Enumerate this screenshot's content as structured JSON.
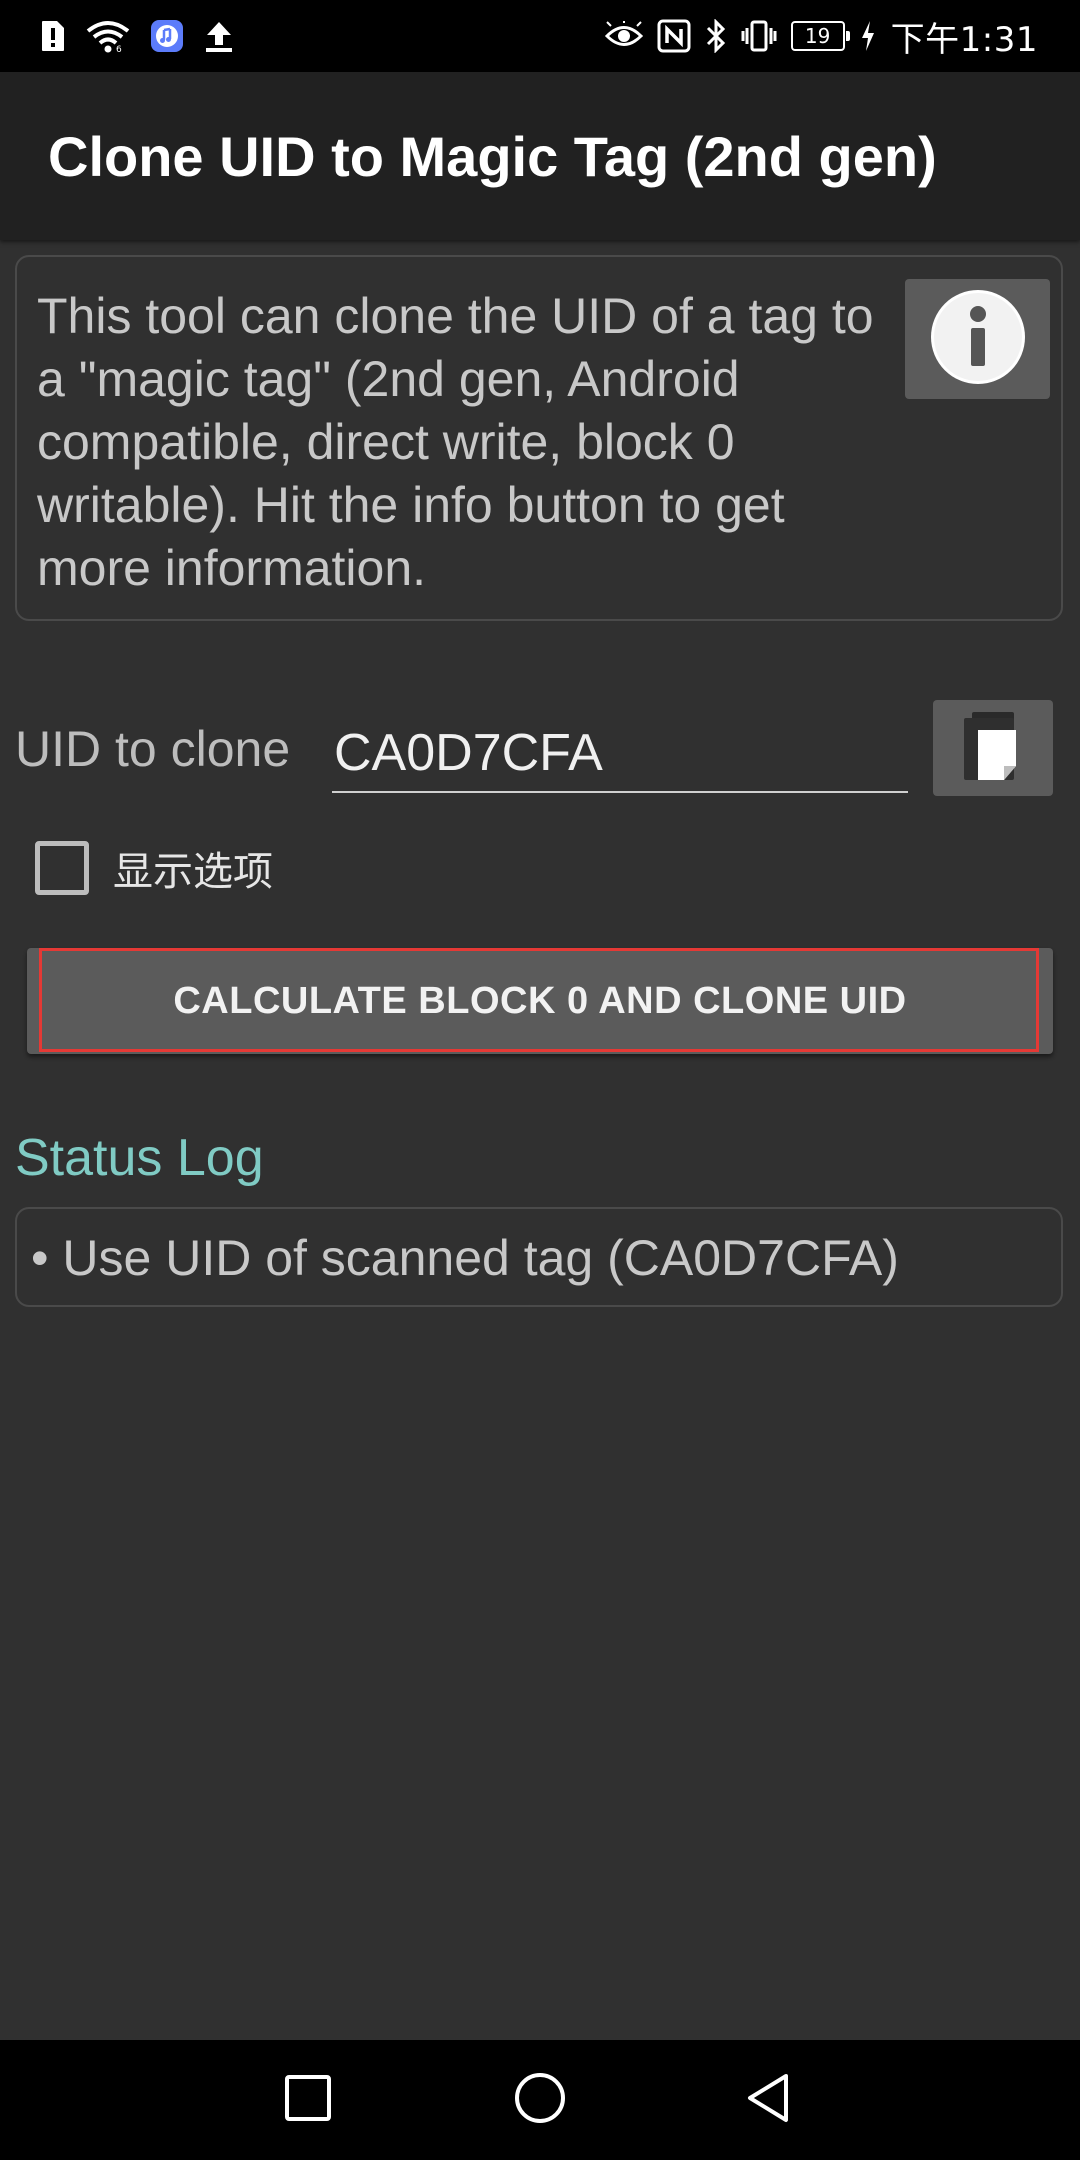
{
  "status_bar": {
    "time": "下午1:31",
    "battery_level": "19",
    "left_icons": [
      "alert-icon",
      "wifi-icon",
      "music-app-icon",
      "upload-icon"
    ],
    "right_icons": [
      "eye-icon",
      "nfc-icon",
      "bluetooth-icon",
      "vibrate-icon",
      "battery-icon",
      "charging-icon"
    ]
  },
  "app_bar": {
    "title": "Clone UID to Magic Tag (2nd gen)"
  },
  "info": {
    "text": "This tool can clone the UID of a tag to a \"magic tag\" (2nd gen, Android compatible, direct write, block 0 writable). Hit the info button to get more information.",
    "button_icon": "info-icon"
  },
  "uid": {
    "label": "UID to clone",
    "value": "CA0D7CFA",
    "paste_icon": "paste-icon"
  },
  "options": {
    "label": "显示选项",
    "checked": false
  },
  "action": {
    "label": "CALCULATE BLOCK 0 AND CLONE UID"
  },
  "status_log": {
    "heading": "Status Log",
    "entries": [
      "• Use UID of scanned tag (CA0D7CFA)"
    ]
  },
  "navigation": {
    "icons": [
      "recents-icon",
      "home-icon",
      "back-icon"
    ]
  },
  "colors": {
    "background": "#303030",
    "app_bar": "#212121",
    "accent": "#80cbc4",
    "button": "#5b5b5b",
    "focus_outline": "#e53935"
  }
}
